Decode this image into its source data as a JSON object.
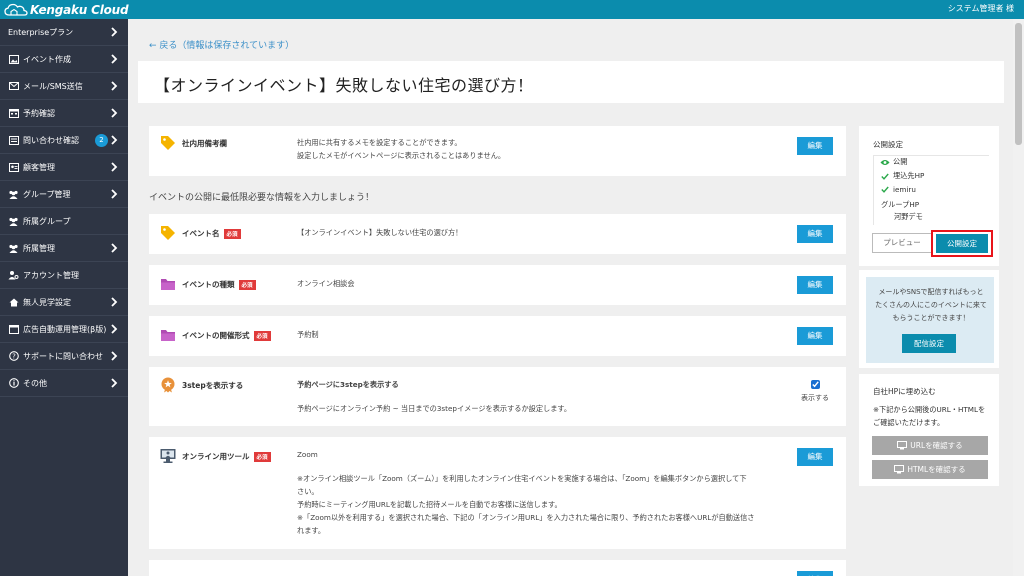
{
  "header": {
    "logo_text": "Kengaku Cloud",
    "user_name": "システム管理者 様"
  },
  "sidebar": {
    "items": [
      {
        "label": "Enterpriseプラン",
        "icon": "none",
        "chevron": true
      },
      {
        "label": "イベント作成",
        "icon": "image-icon",
        "chevron": true
      },
      {
        "label": "メール/SMS送信",
        "icon": "mail-icon",
        "chevron": true
      },
      {
        "label": "予約確認",
        "icon": "calendar-icon",
        "chevron": true
      },
      {
        "label": "問い合わせ確認",
        "icon": "inbox-icon",
        "chevron": true,
        "badge": "2"
      },
      {
        "label": "顧客管理",
        "icon": "address-card-icon",
        "chevron": true
      },
      {
        "label": "グループ管理",
        "icon": "users-icon",
        "chevron": true
      },
      {
        "label": "所属グループ",
        "icon": "users-icon",
        "chevron": false
      },
      {
        "label": "所属管理",
        "icon": "users-icon",
        "chevron": true
      },
      {
        "label": "アカウント管理",
        "icon": "user-gear-icon",
        "chevron": false
      },
      {
        "label": "無人見学設定",
        "icon": "home-icon",
        "chevron": true
      },
      {
        "label": "広告自動運用管理(β版)",
        "icon": "window-icon",
        "chevron": true
      },
      {
        "label": "サポートに問い合わせ",
        "icon": "question-icon",
        "chevron": true
      },
      {
        "label": "その他",
        "icon": "info-icon",
        "chevron": true
      }
    ]
  },
  "main": {
    "back_link": "← 戻る（情報は保存されています）",
    "title": "【オンラインイベント】失敗しない住宅の選び方！",
    "section_heading": "イベントの公開に最低限必要な情報を入力しましょう！",
    "required_badge": "必須",
    "edit_label": "編集",
    "cards": {
      "memo": {
        "label": "社内用備考欄",
        "text_1": "社内用に共有するメモを設定することができます。",
        "text_2": "設定したメモがイベントページに表示されることはありません。"
      },
      "event_name": {
        "label": "イベント名",
        "text": "【オンラインイベント】失敗しない住宅の選び方！"
      },
      "event_type": {
        "label": "イベントの種類",
        "text": "オンライン相談会"
      },
      "event_format": {
        "label": "イベントの開催形式",
        "text": "予約制"
      },
      "three_step": {
        "label": "3stepを表示する",
        "title": "予約ページに3stepを表示する",
        "text": "予約ページにオンライン予約 ~ 当日までの3stepイメージを表示するか設定します。",
        "checkbox_label": "表示する",
        "checked": true
      },
      "online_tool": {
        "label": "オンライン用ツール",
        "value": "Zoom",
        "note_1": "※オンライン相談ツール「Zoom（ズーム）」を利用したオンライン住宅イベントを実施する場合は、「Zoom」を編集ボタンから選択して下",
        "note_2": "さい。",
        "note_3": "予約時にミーティング用URLを記載した招待メールを自動でお客様に送信します。",
        "note_4": "※「Zoom以外を利用する」を選択された場合、下記の「オンライン用URL」を入力された場合に限り、予約されたお客様へURLが自動送信さ",
        "note_5": "れます。"
      }
    }
  },
  "right_panel": {
    "publish": {
      "heading": "公開設定",
      "status": "公開",
      "item_1": "埋込先HP",
      "item_2": "iemiru",
      "group_label": "グループHP",
      "group_value": "河野デモ",
      "preview_button": "プレビュー",
      "publish_button": "公開設定"
    },
    "distribution": {
      "text": "メールやSNSで配信すればもっとたくさんの人にこのイベントに来てもらうことができます！",
      "button": "配信設定"
    },
    "embed": {
      "heading": "自社HPに埋め込む",
      "note": "※下記から公開後のURL・HTMLをご確認いただけます。",
      "url_button": "URLを確認する",
      "html_button": "HTMLを確認する"
    }
  },
  "colors": {
    "topbar": "#0b8cad",
    "sidebar": "#2e3544",
    "accent_button": "#1a9bd7",
    "required": "#e03a3a",
    "highlight": "#e8141a"
  }
}
